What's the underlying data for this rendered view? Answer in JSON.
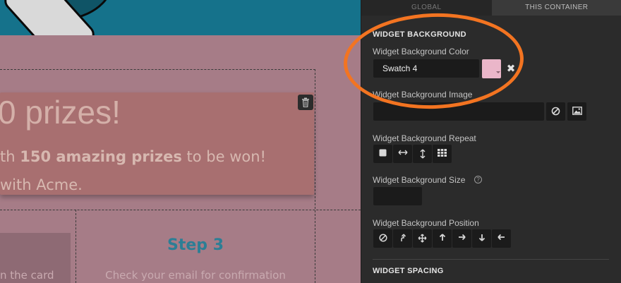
{
  "canvas": {
    "prize_title": "0 prizes!",
    "prize_line1_pre": "th ",
    "prize_line1_bold": "150 amazing prizes",
    "prize_line1_post": " to be won!",
    "prize_line2": "with Acme.",
    "card_text": "n the card",
    "step3_title": "Step 3",
    "step3_text": "Check your email for confirmation"
  },
  "panel": {
    "tabs": [
      {
        "label": "GLOBAL",
        "active": false
      },
      {
        "label": "THIS CONTAINER",
        "active": true
      }
    ],
    "widget_background": {
      "heading": "WIDGET BACKGROUND",
      "color_label": "Widget Background Color",
      "color_value": "Swatch 4",
      "swatch_color": "#eab6c9",
      "clear_label": "✖",
      "image_label": "Widget Background Image",
      "repeat_label": "Widget Background Repeat",
      "size_label": "Widget Background Size",
      "help_label": "?",
      "position_label": "Widget Background Position"
    },
    "widget_spacing": {
      "heading": "WIDGET SPACING"
    }
  },
  "colors": {
    "highlight": "#f37421",
    "hero": "#15728b",
    "section": "#a67c87",
    "panel": "#2b2b2b",
    "accent_text": "#2c7e95"
  }
}
